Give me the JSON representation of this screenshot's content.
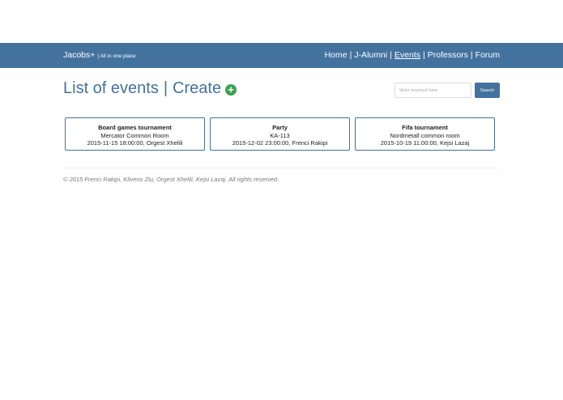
{
  "nav": {
    "brand": "Jacobs+",
    "tagline": "| All in one place",
    "links": [
      "Home",
      "J-Alumni",
      "Events",
      "Professors",
      "Forum"
    ],
    "active": "Events",
    "separator": "|"
  },
  "page": {
    "title": "List of events",
    "separator": "|",
    "create": "Create",
    "plus": "+"
  },
  "search": {
    "placeholder": "Write keyword here",
    "button": "Search"
  },
  "events": [
    {
      "name": "Board games tournament",
      "location": "Mercator Common Room",
      "meta": "2015-11-15 18:00:00, Orgest Xhelili"
    },
    {
      "name": "Party",
      "location": "KA-113",
      "meta": "2015-12-02 23:00:00, Frenci Rakipi"
    },
    {
      "name": "Fifa tournament",
      "location": "Nordmetall common room",
      "meta": "2015-10-19 11:00:00, Kejsi Lazaj"
    }
  ],
  "footer": "© 2015 Frenci Rakipi, Klivens Ziu, Orgest Xhelili, Kejsi Lazaj. All rights reserved.",
  "colors": {
    "primary": "#44729f",
    "create_icon": "#3aa44f"
  }
}
